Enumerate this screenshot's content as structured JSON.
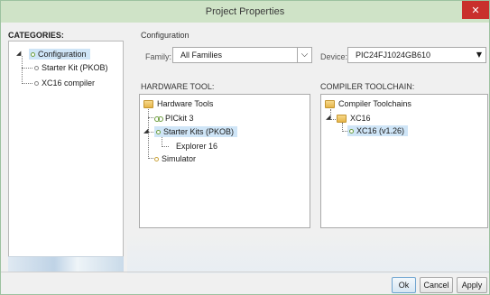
{
  "window": {
    "title": "Project Properties"
  },
  "categories": {
    "header": "CATEGORIES:",
    "items": [
      {
        "label": "Configuration"
      },
      {
        "label": "Starter Kit (PKOB)"
      },
      {
        "label": "XC16 compiler"
      }
    ]
  },
  "configuration": {
    "section_label": "Configuration",
    "family_label": "Family:",
    "family_value": "All Families",
    "device_label": "Device:",
    "device_value": "PIC24FJ1024GB610"
  },
  "hardware_tool": {
    "header": "HARDWARE TOOL:",
    "items": [
      {
        "label": "Hardware Tools"
      },
      {
        "label": "PICkit 3"
      },
      {
        "label": "Starter Kits (PKOB)"
      },
      {
        "label": "Explorer 16"
      },
      {
        "label": "Simulator"
      }
    ]
  },
  "compiler_toolchain": {
    "header": "COMPILER TOOLCHAIN:",
    "items": [
      {
        "label": "Compiler Toolchains"
      },
      {
        "label": "XC16"
      },
      {
        "label": "XC16 (v1.26)"
      }
    ]
  },
  "buttons": {
    "ok": "Ok",
    "cancel": "Cancel",
    "apply": "Apply"
  },
  "colors": {
    "titlebar": "#cfe3c7",
    "close": "#c9302c",
    "selection": "#cfe5f7"
  }
}
